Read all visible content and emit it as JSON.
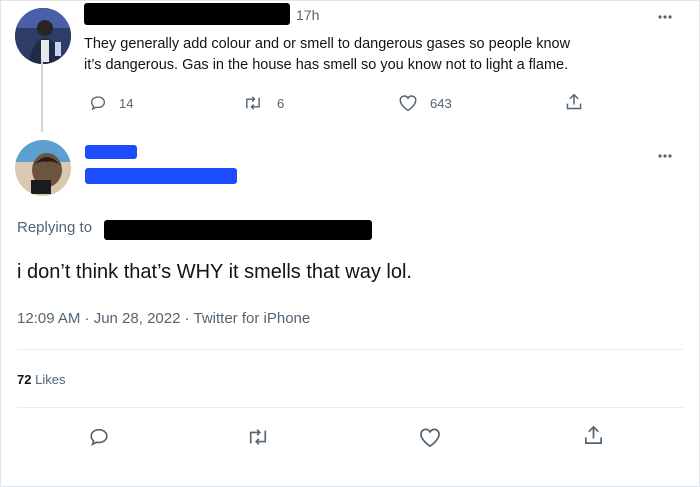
{
  "parent_tweet": {
    "time": "17h",
    "text_line1": "They generally add colour and or smell to dangerous gases so people know",
    "text_line2": "it’s dangerous. Gas in the house has smell so you know not to light a flame.",
    "reply_count": "14",
    "retweet_count": "6",
    "like_count": "643"
  },
  "main_tweet": {
    "replying_to_label": "Replying to",
    "text": "i don’t think that’s WHY it smells that way lol.",
    "timestamp": "12:09 AM · Jun 28, 2022 · Twitter for iPhone",
    "likes_number": "72",
    "likes_label": "Likes"
  },
  "icons": {
    "reply": "reply-icon",
    "retweet": "retweet-icon",
    "like": "heart-icon",
    "share": "share-icon",
    "more": "more-icon"
  },
  "colors": {
    "text": "#0f1419",
    "muted": "#536471",
    "divider": "#e6ecf0",
    "thread_line": "#cfd9de"
  }
}
